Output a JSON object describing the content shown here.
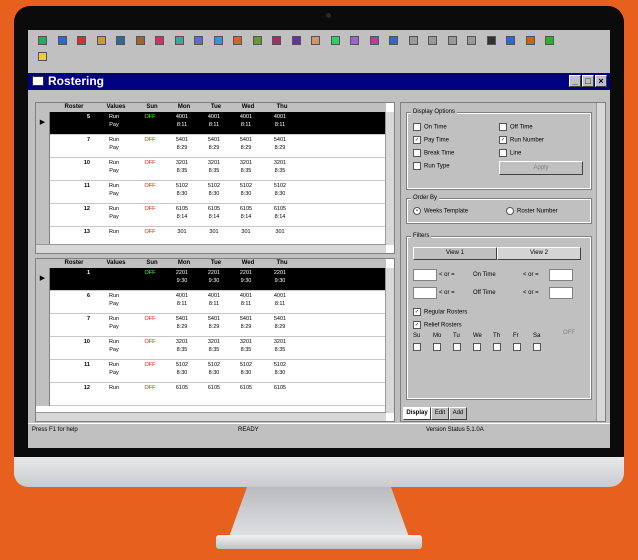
{
  "window": {
    "title": "Rostering",
    "min": "_",
    "max": "□",
    "close": "×"
  },
  "toolbar": {
    "icons": [
      "globe-icon",
      "bar-icon",
      "doc-icon",
      "tool-icon",
      "person-icon",
      "calendar-icon",
      "grid-icon",
      "table-icon",
      "list-icon",
      "list2-icon",
      "window-icon",
      "gear-icon",
      "people-icon",
      "split-icon",
      "map-icon",
      "chart-icon",
      "calc-icon",
      "arrow-icon",
      "monitor-icon",
      "doc2-icon",
      "doc3-icon",
      "doc4-icon",
      "doc5-icon",
      "minimize-icon",
      "save-icon",
      "info-icon",
      "help-icon"
    ]
  },
  "grid_top": {
    "columns": [
      "Roster",
      "Values",
      "Sun",
      "Mon",
      "Tue",
      "Wed",
      "Thu"
    ],
    "rows": [
      {
        "roster": "5",
        "v1": "Run",
        "v2": "Pay",
        "sun": "OFF",
        "mon": [
          "4001",
          "8:11"
        ],
        "tue": [
          "4001",
          "8:11"
        ],
        "wed": [
          "4001",
          "8:11"
        ],
        "thu": [
          "4001",
          "8:11"
        ],
        "selected": true
      },
      {
        "roster": "7",
        "v1": "Run",
        "v2": "Pay",
        "sun": "OFF",
        "mon": [
          "5401",
          "8:29"
        ],
        "tue": [
          "5401",
          "8:29"
        ],
        "wed": [
          "5401",
          "8:29"
        ],
        "thu": [
          "5401",
          "8:29"
        ]
      },
      {
        "roster": "10",
        "v1": "Run",
        "v2": "Pay",
        "sun": "OFF",
        "mon": [
          "3201",
          "8:35"
        ],
        "tue": [
          "3201",
          "8:35"
        ],
        "wed": [
          "3201",
          "8:35"
        ],
        "thu": [
          "3201",
          "8:35"
        ]
      },
      {
        "roster": "11",
        "v1": "Run",
        "v2": "Pay",
        "sun": "OFF",
        "mon": [
          "5102",
          "8:30"
        ],
        "tue": [
          "5102",
          "8:30"
        ],
        "wed": [
          "5102",
          "8:30"
        ],
        "thu": [
          "5102",
          "8:30"
        ]
      },
      {
        "roster": "12",
        "v1": "Run",
        "v2": "Pay",
        "sun": "OFF",
        "mon": [
          "6105",
          "8:14"
        ],
        "tue": [
          "6105",
          "8:14"
        ],
        "wed": [
          "6105",
          "8:14"
        ],
        "thu": [
          "6105",
          "8:14"
        ]
      },
      {
        "roster": "13",
        "v1": "Run",
        "v2": "",
        "sun": "OFF",
        "mon": [
          "301",
          ""
        ],
        "tue": [
          "301",
          ""
        ],
        "wed": [
          "301",
          ""
        ],
        "thu": [
          "301",
          ""
        ]
      }
    ]
  },
  "grid_bottom": {
    "columns": [
      "Roster",
      "Values",
      "Sun",
      "Mon",
      "Tue",
      "Wed",
      "Thu"
    ],
    "rows": [
      {
        "roster": "1",
        "v1": "",
        "v2": "",
        "sun": "OFF",
        "mon": [
          "2201",
          "9:30"
        ],
        "tue": [
          "2201",
          "9:30"
        ],
        "wed": [
          "2201",
          "9:30"
        ],
        "thu": [
          "2201",
          "9:30"
        ],
        "selected": true
      },
      {
        "roster": "6",
        "v1": "Run",
        "v2": "Pay",
        "sun": "",
        "mon": [
          "4001",
          "8:11"
        ],
        "tue": [
          "4001",
          "8:11"
        ],
        "wed": [
          "4001",
          "8:11"
        ],
        "thu": [
          "4001",
          "8:11"
        ]
      },
      {
        "roster": "7",
        "v1": "Run",
        "v2": "Pay",
        "sun": "OFF",
        "mon": [
          "5401",
          "8:29"
        ],
        "tue": [
          "5401",
          "8:29"
        ],
        "wed": [
          "5401",
          "8:29"
        ],
        "thu": [
          "5401",
          "8:29"
        ]
      },
      {
        "roster": "10",
        "v1": "Run",
        "v2": "Pay",
        "sun": "OFF",
        "mon": [
          "3201",
          "8:35"
        ],
        "tue": [
          "3201",
          "8:35"
        ],
        "wed": [
          "3201",
          "8:35"
        ],
        "thu": [
          "3201",
          "8:35"
        ]
      },
      {
        "roster": "11",
        "v1": "Run",
        "v2": "Pay",
        "sun": "OFF",
        "mon": [
          "5102",
          "8:30"
        ],
        "tue": [
          "5102",
          "8:30"
        ],
        "wed": [
          "5102",
          "8:30"
        ],
        "thu": [
          "5102",
          "8:30"
        ]
      },
      {
        "roster": "12",
        "v1": "Run",
        "v2": "",
        "sun": "OFF",
        "mon": [
          "6105",
          ""
        ],
        "tue": [
          "6105",
          ""
        ],
        "wed": [
          "6105",
          ""
        ],
        "thu": [
          "6105",
          ""
        ]
      }
    ]
  },
  "display_options": {
    "label": "Display Options",
    "on_time": "On Time",
    "off_time": "Off Time",
    "pay_time": "Pay Time",
    "run_number": "Run Number",
    "break_time": "Break Time",
    "line": "Line",
    "run_type": "Run Type",
    "apply": "Apply"
  },
  "order_by": {
    "label": "Order By",
    "weeks_template": "Weeks Template",
    "roster_number": "Roster Number"
  },
  "filters": {
    "label": "Filters",
    "tab1": "View 1",
    "tab2": "View 2",
    "on_time_lbl": "On Time",
    "off_time_lbl": "Off Time",
    "ge": "< or =",
    "le": "< or =",
    "regular": "Regular Rosters",
    "relief": "Relief Rosters",
    "days": [
      "Su",
      "Mo",
      "Tu",
      "We",
      "Th",
      "Fr",
      "Sa"
    ],
    "off": "OFF"
  },
  "tabs": {
    "display": "Display",
    "edit": "Edit",
    "add": "Add"
  },
  "status": {
    "help": "Press F1 for help",
    "ready": "READY",
    "version": "Version Status 5.1.0A"
  },
  "colors": {
    "title": "#000080",
    "bg": "#e8601e",
    "off": "#cc2200"
  }
}
